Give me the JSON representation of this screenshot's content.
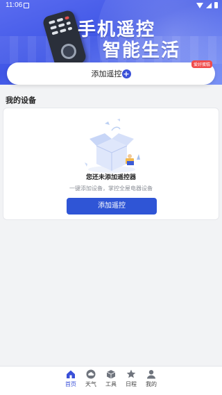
{
  "status_bar": {
    "time": "11:06"
  },
  "hero": {
    "title": "手机遥控",
    "subtitle": "智能生活"
  },
  "add_remote": {
    "label": "添加遥控",
    "badge": "爱好蛋糕"
  },
  "my_devices": {
    "title": "我的设备"
  },
  "empty_state": {
    "title": "您还未添加遥控器",
    "description": "一键添加设备，掌控全屋电器设备",
    "button_label": "添加遥控"
  },
  "bottom_nav": [
    {
      "label": "首页",
      "icon": "home-icon",
      "active": true
    },
    {
      "label": "天气",
      "icon": "cloud-icon",
      "active": false
    },
    {
      "label": "工具",
      "icon": "box-icon",
      "active": false
    },
    {
      "label": "日程",
      "icon": "star-calendar-icon",
      "active": false
    },
    {
      "label": "我的",
      "icon": "user-icon",
      "active": false
    }
  ],
  "colors": {
    "accent": "#3a50d8",
    "button": "#2f55d6",
    "badge": "#f04b4b"
  }
}
